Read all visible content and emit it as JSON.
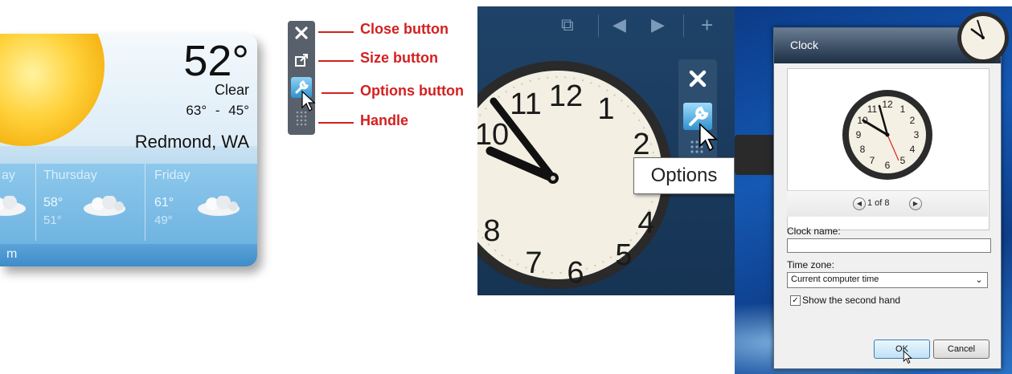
{
  "weather_gadget": {
    "temperature": "52°",
    "condition": "Clear",
    "high": "63°",
    "range_sep": "-",
    "low": "45°",
    "location": "Redmond, WA",
    "forecast": [
      {
        "day": "ay",
        "hi": "",
        "lo": ""
      },
      {
        "day": "Thursday",
        "hi": "58°",
        "lo": "51°"
      },
      {
        "day": "Friday",
        "hi": "61°",
        "lo": "49°"
      }
    ],
    "footer_link": "m",
    "icon": "sun-icon"
  },
  "callouts": [
    {
      "label": "Close button",
      "icon": "close-icon"
    },
    {
      "label": "Size button",
      "icon": "resize-icon"
    },
    {
      "label": "Options button",
      "icon": "wrench-icon"
    },
    {
      "label": "Handle",
      "icon": "grip-handle-icon"
    }
  ],
  "clock_gadget": {
    "toolbar_icons": [
      "multi-window-icon",
      "prev-icon",
      "next-icon",
      "add-icon"
    ],
    "dial_numbers": [
      "10",
      "11",
      "12",
      "1",
      "2",
      "4",
      "5",
      "6",
      "7",
      "8"
    ],
    "tooltip": "Options"
  },
  "clock_dialog": {
    "title": "Clock",
    "pager_text": "1 of 8",
    "clock_name_label": "Clock name:",
    "clock_name_value": "",
    "time_zone_label": "Time zone:",
    "time_zone_value": "Current computer time",
    "show_second_hand_label": "Show the second hand",
    "show_second_hand_checked": true,
    "ok_label": "OK",
    "cancel_label": "Cancel",
    "preview_numbers": [
      "12",
      "1",
      "2",
      "3",
      "4",
      "5",
      "6",
      "7",
      "8",
      "9",
      "10",
      "11"
    ]
  },
  "colors": {
    "callout_red": "#d42020",
    "desktop_blue": "#1a3b5e",
    "dialog_bg": "#f0f0f0"
  }
}
